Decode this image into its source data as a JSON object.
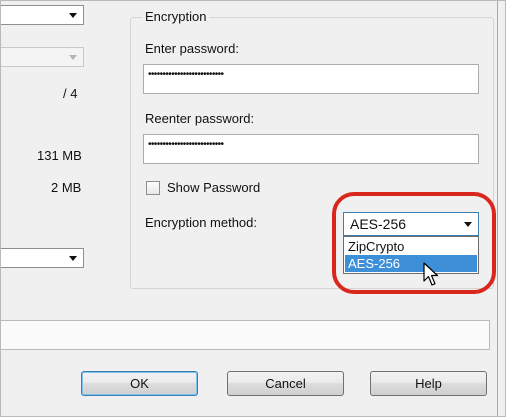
{
  "left_panel": {
    "parts_value": "/ 4",
    "size_value_1": "131 MB",
    "size_value_2": "2 MB"
  },
  "encryption": {
    "group_title": "Encryption",
    "enter_password_label": "Enter password:",
    "enter_password_value": "••••••••••••••••••••••••••",
    "reenter_password_label": "Reenter password:",
    "reenter_password_value": "••••••••••••••••••••••••••",
    "show_password_label": "Show Password",
    "show_password_checked": false,
    "method_label": "Encryption method:",
    "method_selected": "AES-256",
    "method_options": [
      "ZipCrypto",
      "AES-256"
    ],
    "highlighted_option": "AES-256"
  },
  "buttons": {
    "ok": "OK",
    "cancel": "Cancel",
    "help": "Help"
  },
  "colors": {
    "annotation_circle": "#d8281e",
    "selection": "#3d8fd8"
  }
}
